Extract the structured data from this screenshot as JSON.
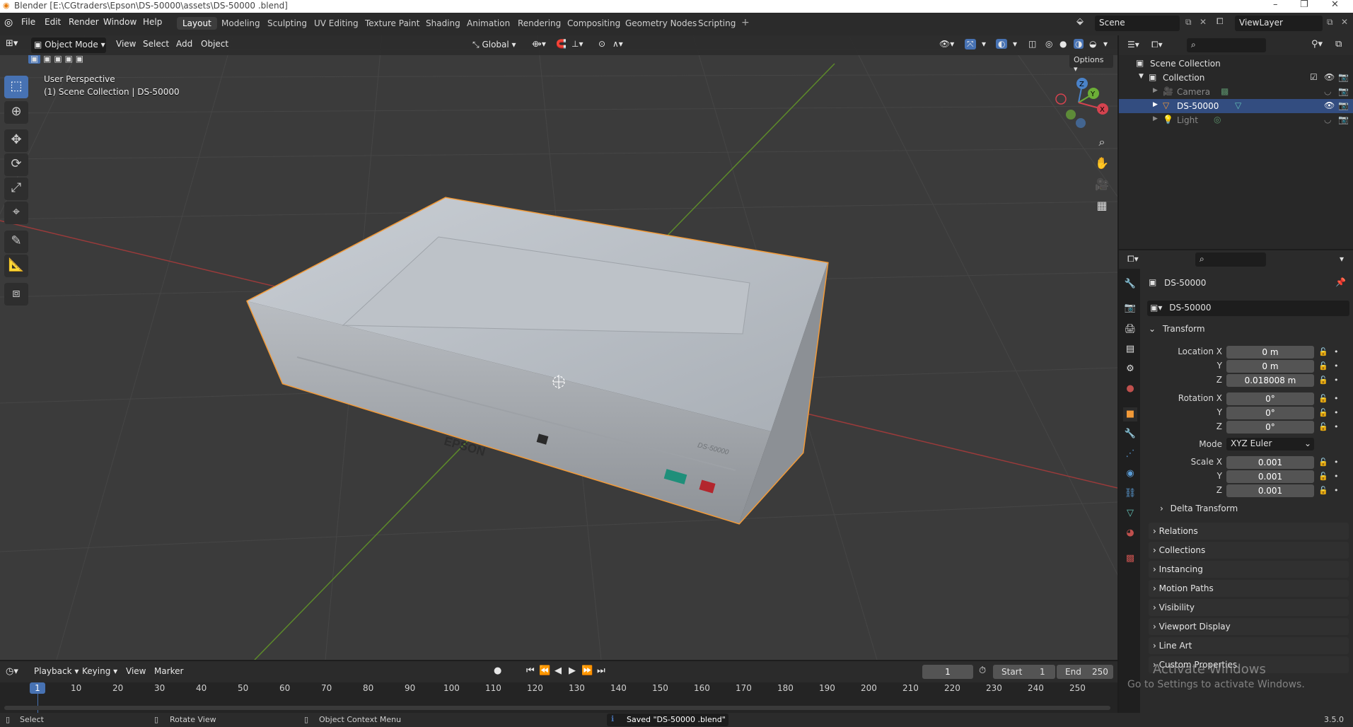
{
  "window": {
    "title": "Blender [E:\\CGtraders\\Epson\\DS-50000\\assets\\DS-50000 .blend]",
    "controls": [
      "–",
      "❐",
      "✕"
    ]
  },
  "menu": [
    "File",
    "Edit",
    "Render",
    "Window",
    "Help"
  ],
  "workspaces": [
    "Layout",
    "Modeling",
    "Sculpting",
    "UV Editing",
    "Texture Paint",
    "Shading",
    "Animation",
    "Rendering",
    "Compositing",
    "Geometry Nodes",
    "Scripting"
  ],
  "active_workspace": "Layout",
  "scene": {
    "name": "Scene",
    "view_layer": "ViewLayer"
  },
  "viewport_header": {
    "mode": "Object Mode",
    "menus": [
      "View",
      "Select",
      "Add",
      "Object"
    ],
    "orientation": "Global",
    "options_label": "Options"
  },
  "viewport": {
    "perspective": "User Perspective",
    "collection_info": "(1) Scene Collection | DS-50000",
    "model_brand": "EPSON",
    "model_label": "DS-50000"
  },
  "tools": [
    "select-box",
    "cursor",
    "move",
    "rotate",
    "scale",
    "transform",
    "annotate",
    "measure",
    "add-cube"
  ],
  "outliner": {
    "root": "Scene Collection",
    "collection": "Collection",
    "items": [
      {
        "name": "Camera",
        "selected": false
      },
      {
        "name": "DS-50000",
        "selected": true
      },
      {
        "name": "Light",
        "selected": false
      }
    ]
  },
  "properties": {
    "object_name": "DS-50000",
    "data_name": "DS-50000",
    "transform_header": "Transform",
    "location_label": "Location X",
    "rotation_label": "Rotation X",
    "scale_label": "Scale X",
    "y_label": "Y",
    "z_label": "Z",
    "mode_label": "Mode",
    "location": [
      "0 m",
      "0 m",
      "0.018008 m"
    ],
    "rotation": [
      "0°",
      "0°",
      "0°"
    ],
    "rotation_mode": "XYZ Euler",
    "scale": [
      "0.001",
      "0.001",
      "0.001"
    ],
    "delta_transform": "Delta Transform",
    "panels": [
      "Relations",
      "Collections",
      "Instancing",
      "Motion Paths",
      "Visibility",
      "Viewport Display",
      "Line Art",
      "Custom Properties"
    ]
  },
  "timeline": {
    "menus": [
      "Playback",
      "Keying",
      "View",
      "Marker"
    ],
    "current_frame": "1",
    "start_label": "Start",
    "start": "1",
    "end_label": "End",
    "end": "250",
    "frame_labels": [
      "10",
      "20",
      "30",
      "40",
      "50",
      "60",
      "70",
      "80",
      "90",
      "100",
      "110",
      "120",
      "130",
      "140",
      "150",
      "160",
      "170",
      "180",
      "190",
      "200",
      "210",
      "220",
      "230",
      "240",
      "250"
    ]
  },
  "watermark": {
    "line1": "Activate Windows",
    "line2": "Go to Settings to activate Windows."
  },
  "status": {
    "select": "Select",
    "rotate": "Rotate View",
    "context": "Object Context Menu",
    "message": "Saved \"DS-50000 .blend\"",
    "version": "3.5.0"
  },
  "colors": {
    "accent": "#4772b3",
    "selection_outline": "#f29a38",
    "x_axis": "#b83b3b",
    "y_axis": "#6a9a2a",
    "background": "#3b3b3b"
  }
}
